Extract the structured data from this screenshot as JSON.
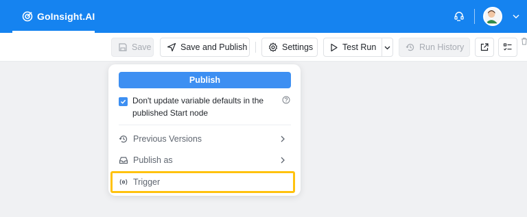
{
  "app": {
    "brand_name": "GoInsight.AI"
  },
  "toolbar": {
    "save_label": "Save",
    "save_publish_label": "Save and Publish",
    "settings_label": "Settings",
    "test_run_label": "Test Run",
    "run_history_label": "Run History"
  },
  "publish_menu": {
    "publish_label": "Publish",
    "checkbox_checked": true,
    "checkbox_text": "Don't update variable defaults in the published Start node",
    "items": [
      {
        "label": "Previous Versions",
        "icon": "history-icon",
        "has_submenu": true
      },
      {
        "label": "Publish as",
        "icon": "inbox-icon",
        "has_submenu": true
      },
      {
        "label": "Trigger",
        "icon": "trigger-icon",
        "has_submenu": false
      }
    ]
  },
  "colors": {
    "header_blue": "#1583f0",
    "primary_button": "#3d8ff2",
    "highlight_border": "#ffc20e",
    "canvas_gray": "#f0f1f3"
  }
}
